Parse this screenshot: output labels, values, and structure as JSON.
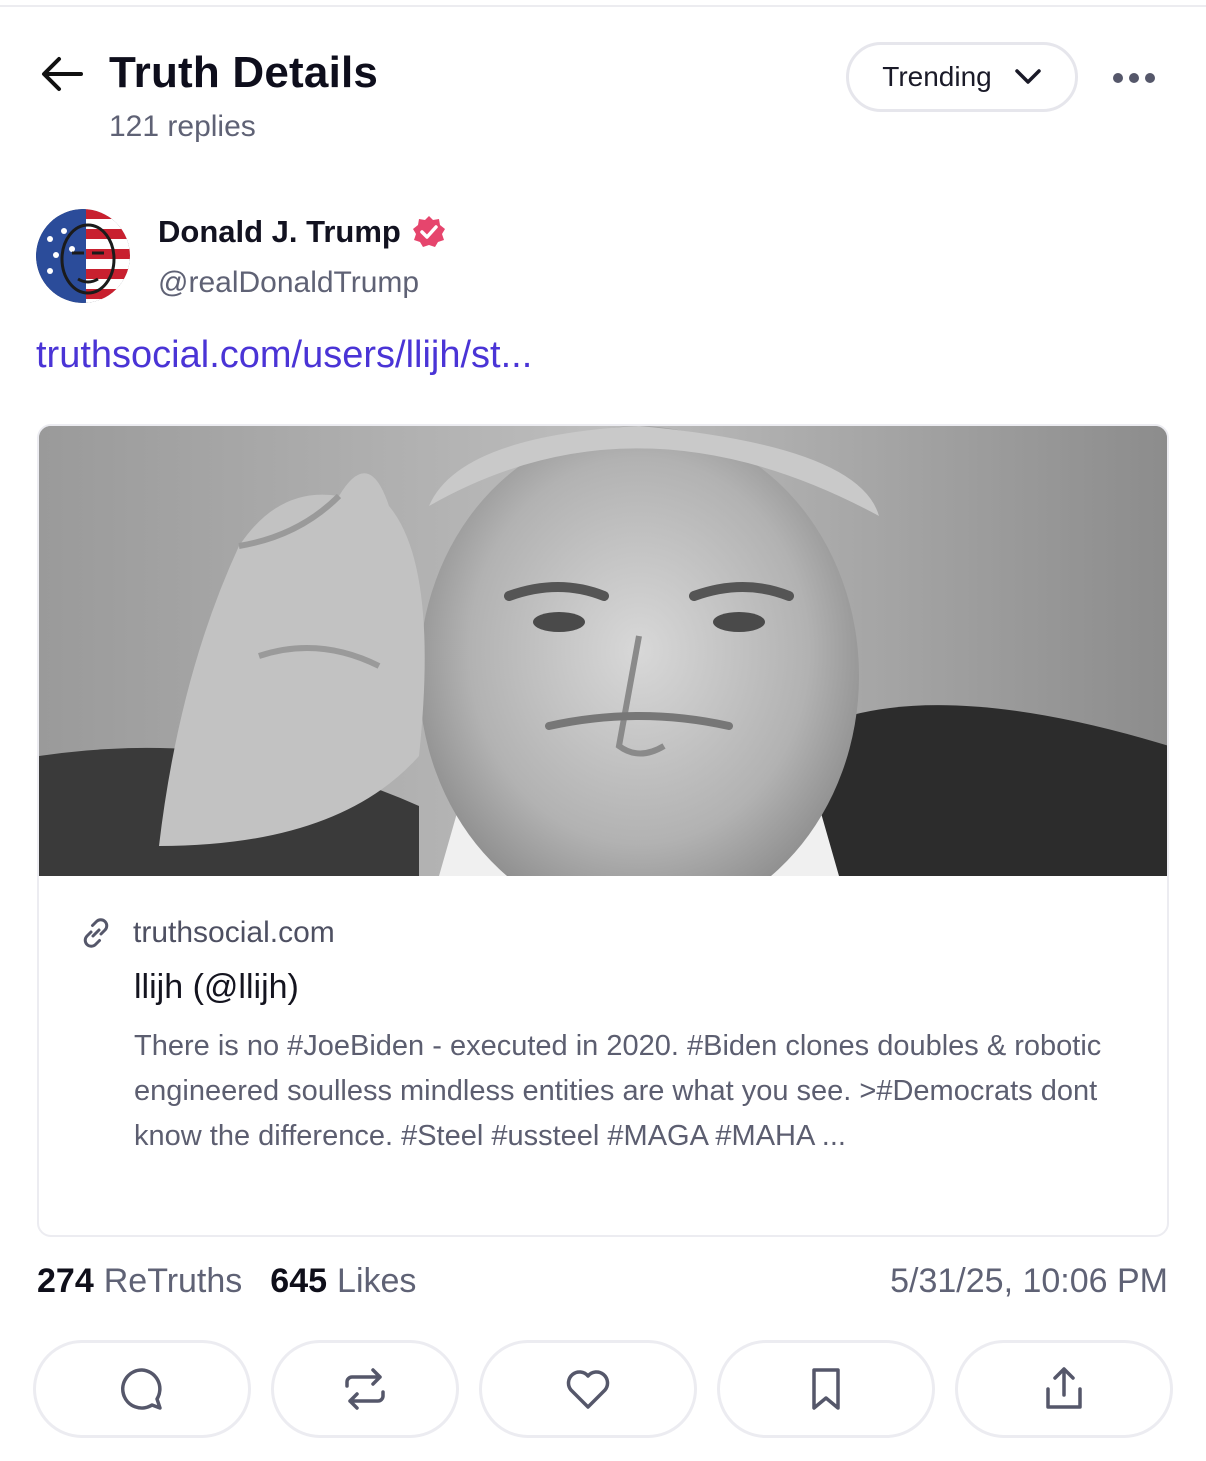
{
  "header": {
    "title": "Truth Details",
    "reply_count": "121 replies",
    "sort_label": "Trending"
  },
  "post": {
    "author_name": "Donald J. Trump",
    "author_handle": "@realDonaldTrump",
    "link_text": "truthsocial.com/users/llijh/st..."
  },
  "card": {
    "domain": "truthsocial.com",
    "title": "llijh (@llijh)",
    "description": "There is no #JoeBiden - executed in 2020. #Biden clones doubles & robotic engineered soulless mindless entities are what you see. >#Democrats dont know the difference. #Steel #ussteel #MAGA #MAHA ..."
  },
  "stats": {
    "retruths_count": "274",
    "retruths_label": "ReTruths",
    "likes_count": "645",
    "likes_label": "Likes",
    "timestamp": "5/31/25, 10:06 PM"
  },
  "icons": {
    "back": "arrow-left-icon",
    "sort": "chevron-down-icon",
    "more": "more-dots-icon",
    "verified": "verified-badge-icon",
    "link": "link-icon",
    "reply": "comment-icon",
    "retruth": "repost-icon",
    "like": "heart-icon",
    "bookmark": "bookmark-icon",
    "share": "share-icon"
  },
  "colors": {
    "link": "#4a34d6",
    "verified_badge": "#e6456d",
    "muted_text": "#5f6275"
  }
}
